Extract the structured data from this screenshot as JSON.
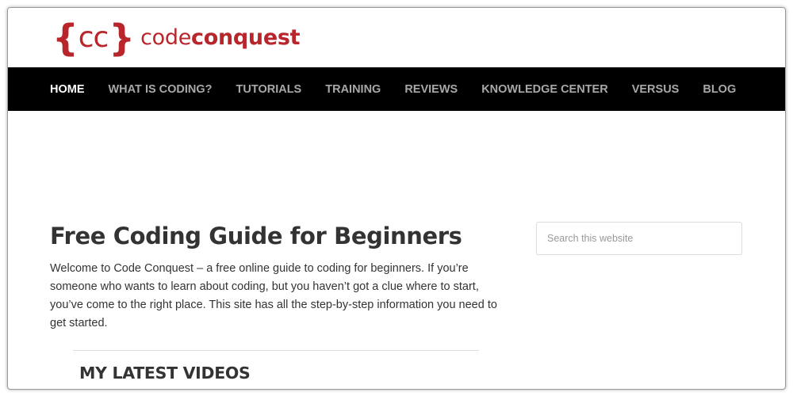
{
  "logo": {
    "mark_open": "{",
    "mark_letters": "cc",
    "mark_close": "}",
    "word1": "code",
    "word2": "conquest",
    "brand_color": "#b8252b"
  },
  "nav": {
    "items": [
      {
        "label": "HOME",
        "active": true
      },
      {
        "label": "WHAT IS CODING?",
        "active": false
      },
      {
        "label": "TUTORIALS",
        "active": false
      },
      {
        "label": "TRAINING",
        "active": false
      },
      {
        "label": "REVIEWS",
        "active": false
      },
      {
        "label": "KNOWLEDGE CENTER",
        "active": false
      },
      {
        "label": "VERSUS",
        "active": false
      },
      {
        "label": "BLOG",
        "active": false
      }
    ],
    "background": "#000000",
    "active_color": "#ffffff",
    "inactive_color": "#a8a8a8"
  },
  "main": {
    "title": "Free Coding Guide for Beginners",
    "intro": "Welcome to Code Conquest – a free online guide to coding for beginners. If you’re someone who wants to learn about coding, but you haven’t got a clue where to start, you’ve come to the right place. This site has all the step-by-step information you need to get started.",
    "section_heading": "MY LATEST VIDEOS"
  },
  "sidebar": {
    "search": {
      "placeholder": "Search this website",
      "value": ""
    }
  }
}
